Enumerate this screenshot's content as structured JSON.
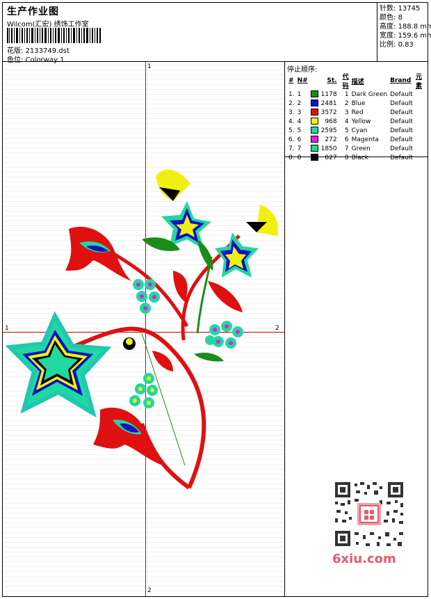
{
  "header": {
    "title": "生产作业图",
    "subtitle": "Wilcom(汇宏) 绣饰工作室",
    "pattern_label": "花版:",
    "pattern_value": "2133749.dst",
    "colorway_label": "色位:",
    "colorway_value": "Colorway 1"
  },
  "stats": {
    "stitches_label": "针数:",
    "stitches_value": "13745",
    "colors_label": "颜色:",
    "colors_value": "8",
    "height_label": "高度:",
    "height_value": "188.8 mm",
    "width_label": "宽度:",
    "width_value": "159.6 mm",
    "scale_label": "比例:",
    "scale_value": "0.83"
  },
  "panel": {
    "title": "停止顺序:",
    "columns": [
      "#",
      "N#",
      "St.",
      "代码",
      "描述",
      "Brand",
      "元素"
    ],
    "rows": [
      {
        "n": "1.",
        "nn": "1",
        "color": "#1a8c1a",
        "st": "1178",
        "code": "1",
        "desc": "Dark Green",
        "brand": "Default"
      },
      {
        "n": "2.",
        "nn": "2",
        "color": "#1010e0",
        "st": "2481",
        "code": "2",
        "desc": "Blue",
        "brand": "Default"
      },
      {
        "n": "3.",
        "nn": "3",
        "color": "#e01010",
        "st": "3572",
        "code": "3",
        "desc": "Red",
        "brand": "Default"
      },
      {
        "n": "4.",
        "nn": "4",
        "color": "#f0f010",
        "st": "968",
        "code": "4",
        "desc": "Yellow",
        "brand": "Default"
      },
      {
        "n": "5.",
        "nn": "5",
        "color": "#20d8a0",
        "st": "2595",
        "code": "5",
        "desc": "Cyan",
        "brand": "Default"
      },
      {
        "n": "6.",
        "nn": "6",
        "color": "#e020e0",
        "st": "272",
        "code": "6",
        "desc": "Magenta",
        "brand": "Default"
      },
      {
        "n": "7.",
        "nn": "7",
        "color": "#20d880",
        "st": "1850",
        "code": "7",
        "desc": "Green",
        "brand": "Default"
      },
      {
        "n": "8.",
        "nn": "8",
        "color": "#000000",
        "st": "827",
        "code": "8",
        "desc": "Black",
        "brand": "Default"
      }
    ]
  },
  "axes": {
    "top": "1",
    "bottom": "2",
    "left": "1",
    "right": "2"
  },
  "watermark": "6xiu.com"
}
